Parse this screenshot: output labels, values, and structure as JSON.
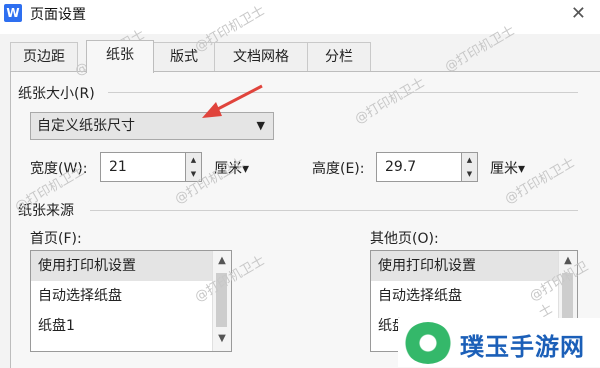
{
  "window": {
    "icon_letter": "W",
    "title": "页面设置",
    "close_glyph": "✕"
  },
  "tabs": [
    {
      "label": "页边距"
    },
    {
      "label": "纸张",
      "active": true
    },
    {
      "label": "版式"
    },
    {
      "label": "文档网格"
    },
    {
      "label": "分栏"
    }
  ],
  "paper_size": {
    "group_label": "纸张大小(R)",
    "selected": "自定义纸张尺寸",
    "width_label": "宽度(W):",
    "width_value": "21",
    "width_unit": "厘米▾",
    "height_label": "高度(E):",
    "height_value": "29.7",
    "height_unit": "厘米▾"
  },
  "paper_source": {
    "group_label": "纸张来源",
    "first_page_label": "首页(F):",
    "other_pages_label": "其他页(O):",
    "first_page_items": [
      "使用打印机设置",
      "自动选择纸盘",
      "纸盘1"
    ],
    "other_pages_items": [
      "使用打印机设置",
      "自动选择纸盘",
      "纸盘1"
    ]
  },
  "watermark_text": "@打印机卫士",
  "logo_text": "璞玉手游网",
  "colors": {
    "arrow": "#e0443c",
    "logo_blue": "#1b5fb8",
    "logo_green": "#34b86a",
    "app_icon": "#2e6ff0"
  }
}
